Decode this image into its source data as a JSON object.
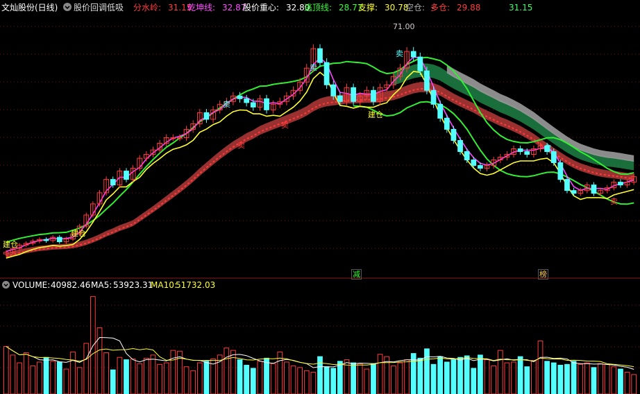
{
  "header": {
    "title": "文灿股份(日线)",
    "formula_name": "股价回调低吸",
    "indicators": [
      {
        "label": "分水岭:",
        "value": "31.15",
        "color": "#ff3b3b"
      },
      {
        "label": "乾坤线:",
        "value": "32.87",
        "color": "#ff4dff"
      },
      {
        "label": "股价重心:",
        "value": "32.80",
        "color": "#ffffff"
      },
      {
        "label": "逃顶线:",
        "value": "28.77",
        "color": "#33ff33"
      },
      {
        "label": "支撑:",
        "value": "30.78",
        "color": "#ffff33"
      },
      {
        "label": "空仓:",
        "value": "-",
        "color": "#aaaaaa"
      },
      {
        "label": "多仓:",
        "value": "29.88",
        "color": "#ff3b3b"
      }
    ],
    "last_value": "31.15",
    "last_value_color": "#33ff66"
  },
  "volume_header": {
    "volume_label": "VOLUME:",
    "volume_value": "40982.46",
    "ma5_label": "MA5:",
    "ma5_value": "53923.31",
    "ma10_label": "MA10:",
    "ma10_value": "51732.03"
  },
  "price_labels": {
    "high_mark": "71.00"
  },
  "signals": {
    "build": "建仓",
    "sell": "卖",
    "reduce": "减",
    "rank": "榜"
  },
  "colors": {
    "up": "#ff3b3b",
    "down": "#54ffff",
    "ma_white": "#ffffff",
    "ma_yellow": "#ffff33",
    "green_line": "#33ee33",
    "magenta_line": "#ff44ff",
    "band_red": "#b43a3a",
    "band_green": "#1f8a4a",
    "band_gray": "#9a9a9a"
  },
  "chart_data": {
    "type": "candlestick",
    "close": [
      29.9,
      30.6,
      31.2,
      31.5,
      31.9,
      32.2,
      32.0,
      32.6,
      31.8,
      32.3,
      33.2,
      34.6,
      36.6,
      38.6,
      40.6,
      43.0,
      42.0,
      44.5,
      43.0,
      45.0,
      46.8,
      47.5,
      48.3,
      49.5,
      50.5,
      50.5,
      50.5,
      52.0,
      53.0,
      55.0,
      53.8,
      55.5,
      56.5,
      57.0,
      58.0,
      57.5,
      56.8,
      56.0,
      57.5,
      55.5,
      56.5,
      57.0,
      58.0,
      59.0,
      60.5,
      63.0,
      66.5,
      64.0,
      60.0,
      58.0,
      57.0,
      59.5,
      57.0,
      58.0,
      59.0,
      57.0,
      59.5,
      60.0,
      61.5,
      63.0,
      66.0,
      65.0,
      62.5,
      59.0,
      56.5,
      54.0,
      52.0,
      50.0,
      48.0,
      46.5,
      45.5,
      45.0,
      45.5,
      46.5,
      47.0,
      47.5,
      48.5,
      48.0,
      47.5,
      48.5,
      49.0,
      48.0,
      46.0,
      43.0,
      41.0,
      40.5,
      41.0,
      42.0,
      40.5,
      41.0,
      41.5,
      42.5,
      42.0,
      42.5,
      43.5
    ],
    "volume": [
      61000,
      50000,
      40000,
      53000,
      36000,
      41000,
      47000,
      42000,
      41000,
      32000,
      54000,
      34000,
      65000,
      125000,
      85000,
      53000,
      31000,
      47000,
      44000,
      45000,
      39000,
      46000,
      50000,
      38000,
      40000,
      56000,
      55000,
      35000,
      30000,
      40000,
      42000,
      45000,
      50000,
      59000,
      56000,
      44000,
      37000,
      33000,
      42000,
      46000,
      39000,
      54000,
      41000,
      36000,
      34000,
      30000,
      28000,
      48000,
      35000,
      33000,
      42000,
      44000,
      40000,
      39000,
      32000,
      39000,
      51000,
      48000,
      36000,
      40000,
      44000,
      52000,
      46000,
      58000,
      38000,
      48000,
      41000,
      44000,
      47000,
      49000,
      33000,
      50000,
      44000,
      36000,
      56000,
      40000,
      41000,
      48000,
      35000,
      43000,
      68000,
      42000,
      40000,
      37000,
      38000,
      42000,
      38000,
      40000,
      34000,
      39000,
      38000,
      35000,
      32000,
      28000,
      25000
    ],
    "ma5_last": 53923.31,
    "ma10_last": 51732.03
  }
}
